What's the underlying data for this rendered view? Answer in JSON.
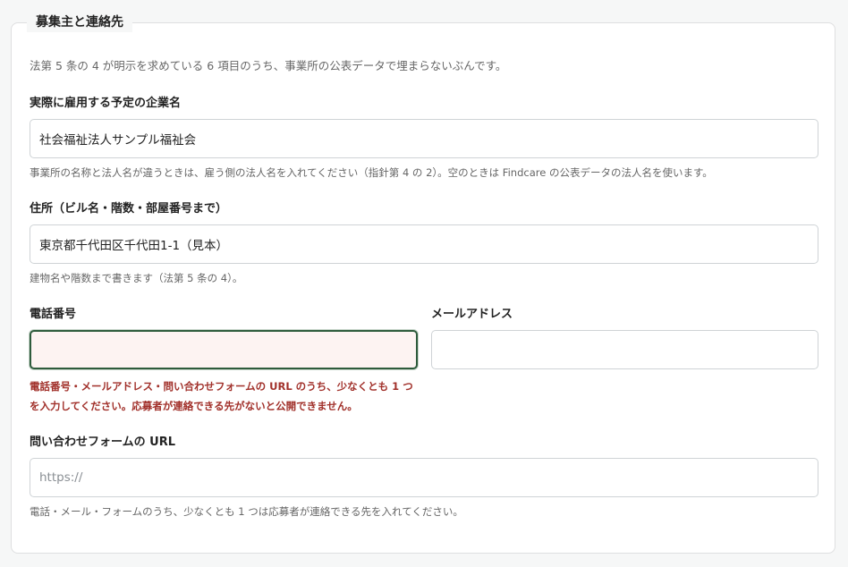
{
  "section": {
    "legend": "募集主と連絡先",
    "intro": "法第 5 条の 4 が明示を求めている 6 項目のうち、事業所の公表データで埋まらないぶんです。"
  },
  "company": {
    "label": "実際に雇用する予定の企業名",
    "value": "社会福祉法人サンプル福祉会",
    "help": "事業所の名称と法人名が違うときは、雇う側の法人名を入れてください（指針第 4 の 2）。空のときは Findcare の公表データの法人名を使います。"
  },
  "address": {
    "label": "住所（ビル名・階数・部屋番号まで）",
    "value": "東京都千代田区千代田1-1（見本）",
    "help": "建物名や階数まで書きます（法第 5 条の 4）。"
  },
  "phone": {
    "label": "電話番号",
    "value": "",
    "error": "電話番号・メールアドレス・問い合わせフォームの URL のうち、少なくとも 1 つを入力してください。応募者が連絡できる先がないと公開できません。"
  },
  "email": {
    "label": "メールアドレス",
    "value": ""
  },
  "form_url": {
    "label": "問い合わせフォームの URL",
    "placeholder": "https://",
    "value": "",
    "help": "電話・メール・フォームのうち、少なくとも 1 つは応募者が連絡できる先を入れてください。"
  },
  "colors": {
    "error_text": "#a1302a",
    "error_border": "#2e5b3c",
    "error_bg": "#fdf3f2"
  }
}
